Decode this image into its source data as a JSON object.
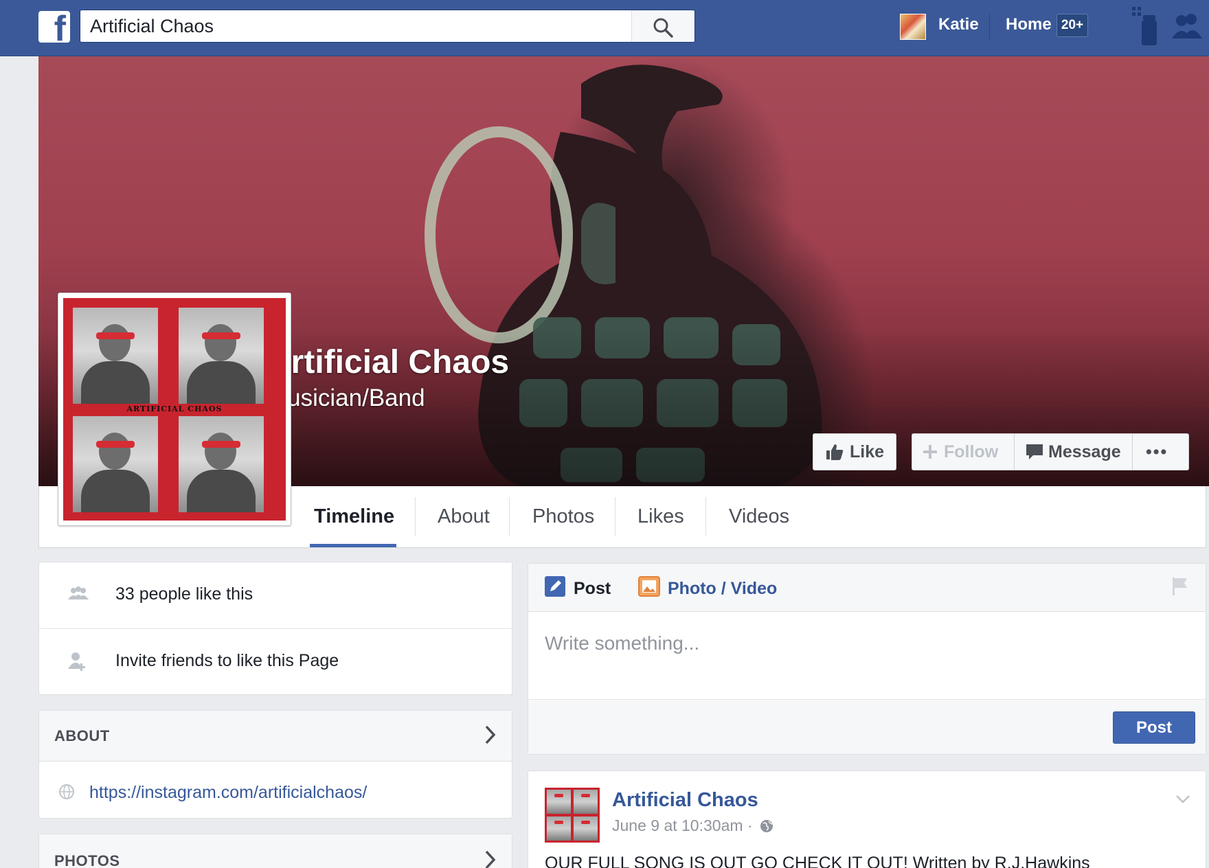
{
  "topbar": {
    "logo_letter": "f",
    "search_value": "Artificial Chaos",
    "user_name": "Katie",
    "home_label": "Home",
    "home_badge": "20+"
  },
  "page": {
    "name": "Artificial Chaos",
    "category": "Musician/Band",
    "profile_banner_text": "ARTIFICIAL CHAOS"
  },
  "actions": {
    "like": "Like",
    "follow": "Follow",
    "message": "Message",
    "more": "•••"
  },
  "tabs": [
    {
      "label": "Timeline",
      "active": true
    },
    {
      "label": "About"
    },
    {
      "label": "Photos"
    },
    {
      "label": "Likes"
    },
    {
      "label": "Videos"
    }
  ],
  "left": {
    "likes_text": "33 people like this",
    "invite_text": "Invite friends to like this Page",
    "about_title": "ABOUT",
    "about_link": "https://instagram.com/artificialchaos/",
    "photos_title": "PHOTOS"
  },
  "composer": {
    "post_tab": "Post",
    "photo_tab": "Photo / Video",
    "placeholder": "Write something...",
    "post_button": "Post"
  },
  "feed": {
    "author": "Artificial Chaos",
    "time": "June 9 at 10:30am ·",
    "text": "OUR FULL SONG IS OUT GO CHECK IT OUT! Written by R.J.Hawkins"
  },
  "colors": {
    "brand": "#3b5998",
    "link": "#365899",
    "button_primary": "#4267b2",
    "cover_red": "#a0404f"
  }
}
